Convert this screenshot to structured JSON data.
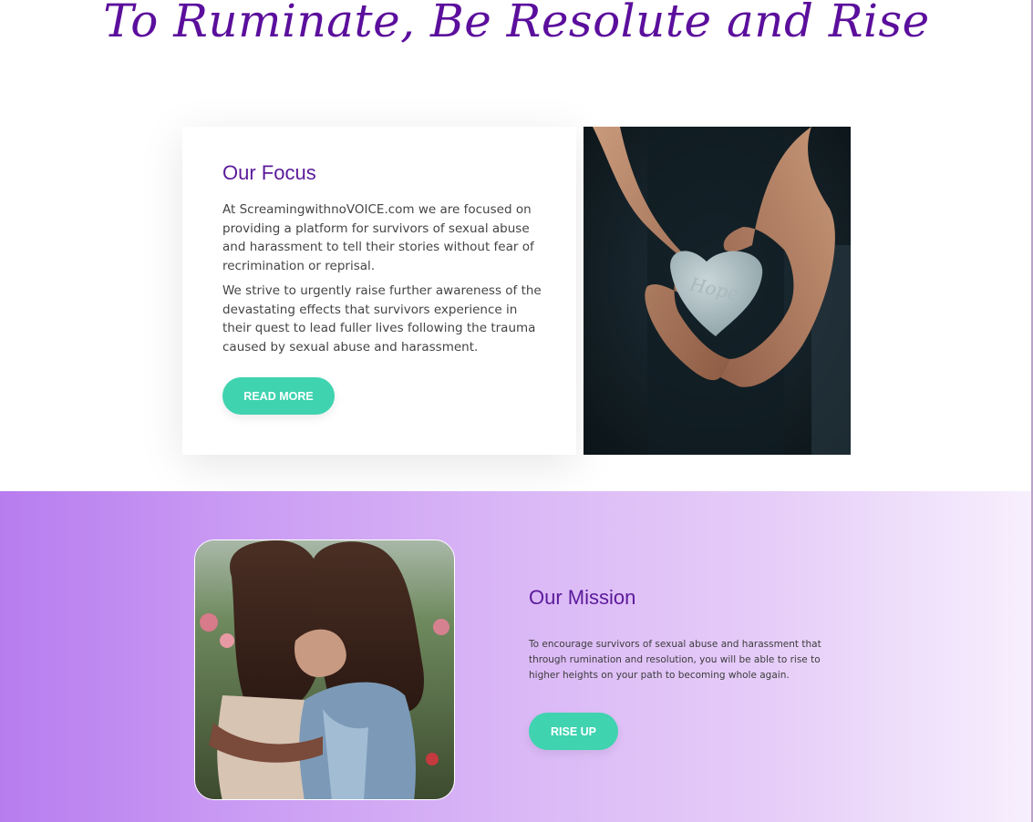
{
  "hero": {
    "title": "To Ruminate, Be Resolute and Rise"
  },
  "focus": {
    "heading": "Our Focus",
    "paragraph1": "At ScreamingwithnoVOICE.com we are focused on providing a platform for survivors of sexual abuse and harassment to tell their stories without fear of recrimination or reprisal.",
    "paragraph2": "We strive to urgently raise further awareness of the devastating effects that survivors experience in their quest to lead fuller lives following the trauma caused by sexual abuse and harassment.",
    "button_label": "READ MORE",
    "image_icon": "hands-holding-heart-stone-photo",
    "stone_text": "Hope"
  },
  "mission": {
    "heading": "Our Mission",
    "text": "To encourage survivors of sexual abuse and harassment that through rumination and resolution, you will be able to rise to higher heights on your path to becoming whole again.",
    "button_label": "RISE UP",
    "image_icon": "two-women-embracing-photo"
  },
  "colors": {
    "title_purple": "#5b0f9c",
    "heading_purple": "#5b1a9a",
    "button_teal": "#3fd3b0",
    "gradient_start": "#b77cef",
    "gradient_end": "#f7effd"
  }
}
